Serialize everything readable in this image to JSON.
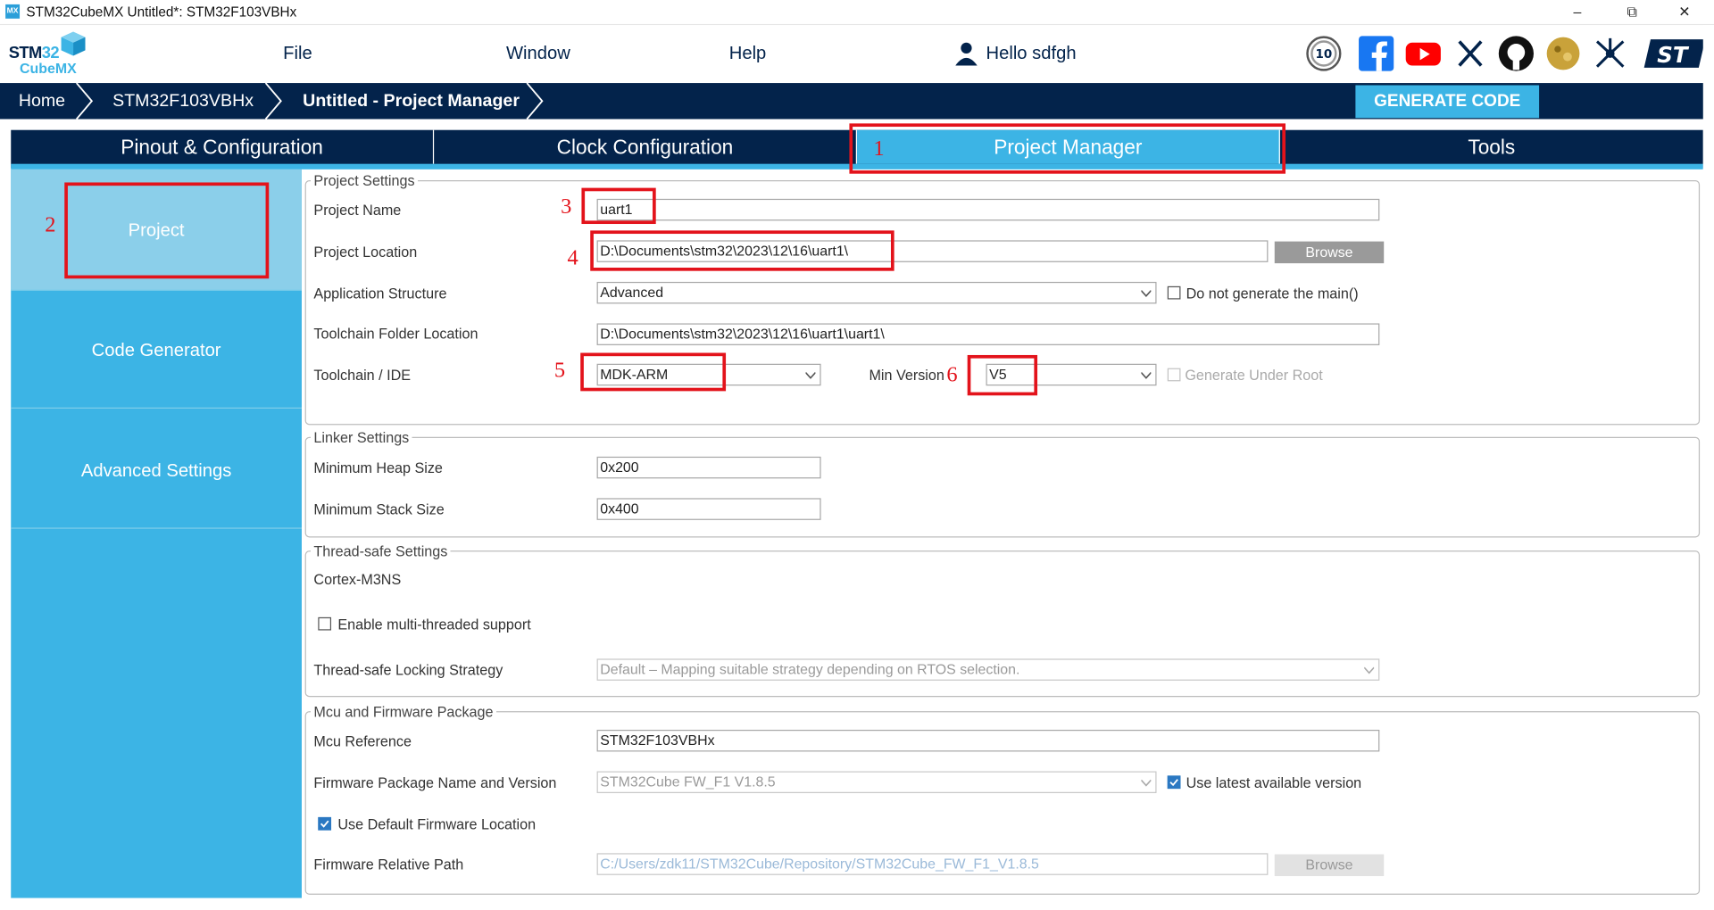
{
  "window": {
    "title": "STM32CubeMX Untitled*: STM32F103VBHx",
    "app_icon": "MX",
    "controls": {
      "minimize": "–",
      "restore": "⧉",
      "close": "✕"
    }
  },
  "logo": {
    "line1_a": "STM",
    "line1_b": "32",
    "line2": "CubeMX"
  },
  "menu": {
    "file": "File",
    "window": "Window",
    "help": "Help",
    "user": "Hello sdfgh"
  },
  "breadcrumb": {
    "home": "Home",
    "device": "STM32F103VBHx",
    "project": "Untitled - Project Manager"
  },
  "generate_label": "GENERATE CODE",
  "tabs": [
    {
      "label": "Pinout & Configuration"
    },
    {
      "label": "Clock Configuration"
    },
    {
      "label": "Project Manager"
    },
    {
      "label": "Tools"
    }
  ],
  "sidebar": {
    "items": [
      {
        "label": "Project"
      },
      {
        "label": "Code Generator"
      },
      {
        "label": "Advanced Settings"
      }
    ]
  },
  "project_settings": {
    "legend": "Project Settings",
    "name_label": "Project Name",
    "name_value": "uart1",
    "location_label": "Project Location",
    "location_value": "D:\\Documents\\stm32\\2023\\12\\16\\uart1\\",
    "browse": "Browse",
    "structure_label": "Application Structure",
    "structure_value": "Advanced",
    "no_main_label": "Do not generate the main()",
    "toolchain_folder_label": "Toolchain Folder Location",
    "toolchain_folder_value": "D:\\Documents\\stm32\\2023\\12\\16\\uart1\\uart1\\",
    "toolchain_label": "Toolchain / IDE",
    "toolchain_value": "MDK-ARM",
    "min_version_label": "Min Version",
    "min_version_value": "V5",
    "generate_under_root_label": "Generate Under Root"
  },
  "linker_settings": {
    "legend": "Linker Settings",
    "heap_label": "Minimum Heap Size",
    "heap_value": "0x200",
    "stack_label": "Minimum Stack Size",
    "stack_value": "0x400"
  },
  "thread_settings": {
    "legend": "Thread-safe Settings",
    "core": "Cortex-M3NS",
    "multi_label": "Enable multi-threaded support",
    "strategy_label": "Thread-safe Locking Strategy",
    "strategy_value": "Default  –  Mapping suitable strategy depending on RTOS selection."
  },
  "mcu_package": {
    "legend": "Mcu and Firmware Package",
    "ref_label": "Mcu Reference",
    "ref_value": "STM32F103VBHx",
    "fw_label": "Firmware Package Name and Version",
    "fw_value": "STM32Cube FW_F1 V1.8.5",
    "use_latest_label": "Use latest available version",
    "use_default_label": "Use Default Firmware Location",
    "path_label": "Firmware Relative Path",
    "path_value": "C:/Users/zdk11/STM32Cube/Repository/STM32Cube_FW_F1_V1.8.5",
    "browse": "Browse"
  },
  "annotations": {
    "n1": "1",
    "n2": "2",
    "n3": "3",
    "n4": "4",
    "n5": "5",
    "n6": "6"
  },
  "icons": [
    "10-years-icon",
    "facebook-icon",
    "youtube-icon",
    "x-icon",
    "github-icon",
    "community-icon",
    "network-icon",
    "st-logo-icon",
    "user-icon"
  ],
  "colors": {
    "navy": "#03234b",
    "accent": "#3cb4e5",
    "annotation_red": "#e3131b"
  }
}
